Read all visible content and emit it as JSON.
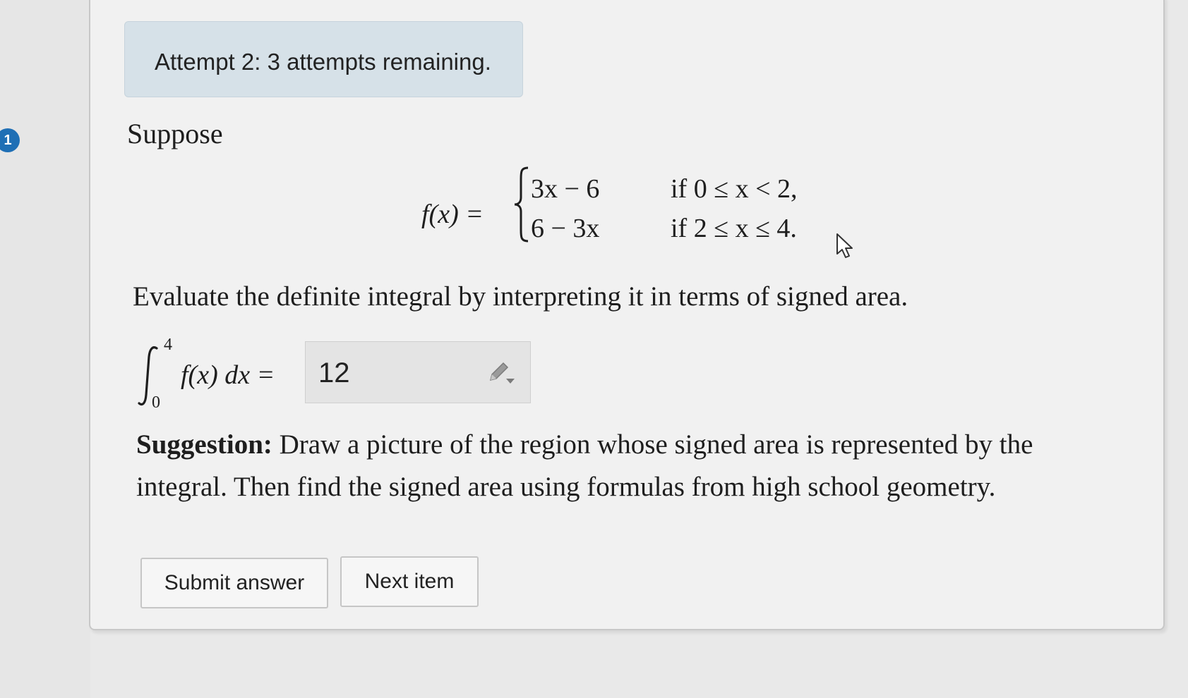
{
  "question_number": "1",
  "attempt_notice": "Attempt 2: 3 attempts remaining.",
  "prompt_intro": "Suppose",
  "function": {
    "lhs": "f(x) =",
    "cases": [
      {
        "expr": "3x − 6",
        "condition": "if 0 ≤ x < 2,"
      },
      {
        "expr": "6 − 3x",
        "condition": "if 2 ≤ x ≤ 4."
      }
    ]
  },
  "instruction": "Evaluate the definite integral by interpreting it in terms of signed area.",
  "integral": {
    "upper": "4",
    "lower": "0",
    "integrand": "f(x) dx =",
    "answer_value": "12"
  },
  "suggestion": {
    "label": "Suggestion:",
    "line1": "Draw a picture of the region whose signed area is represented by the",
    "line2": "integral. Then find the signed area using formulas from high school geometry."
  },
  "buttons": {
    "submit": "Submit answer",
    "next": "Next item"
  },
  "icons": {
    "answer_tool": "pencil-dropdown-icon",
    "pointer": "mouse-cursor-icon"
  }
}
